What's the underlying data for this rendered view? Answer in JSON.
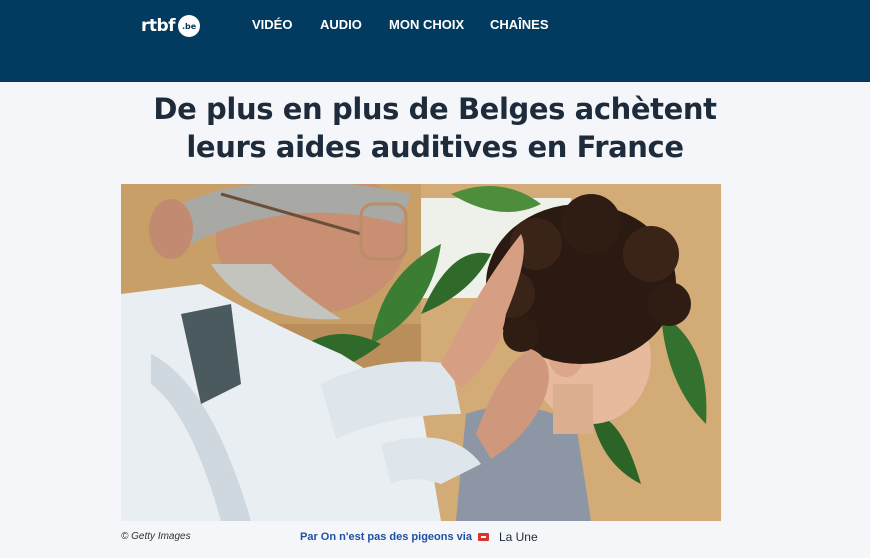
{
  "header": {
    "logo": {
      "word": "rtbf",
      "badge": ".be"
    },
    "nav": [
      {
        "label": "VIDÉO"
      },
      {
        "label": "AUDIO"
      },
      {
        "label": "MON CHOIX"
      },
      {
        "label": "CHAÎNES"
      }
    ]
  },
  "article": {
    "title_line1": "De plus en plus de Belges achètent",
    "title_line2": "leurs aides auditives en France",
    "image_credit": "© Getty Images",
    "byline_prefix": "Par On n'est pas des pigeons via",
    "source": "La Une"
  },
  "colors": {
    "header_bg": "#033b60",
    "page_bg": "#f5f6fa",
    "headline": "#1d2b3a",
    "byline": "#1f4fa0"
  }
}
